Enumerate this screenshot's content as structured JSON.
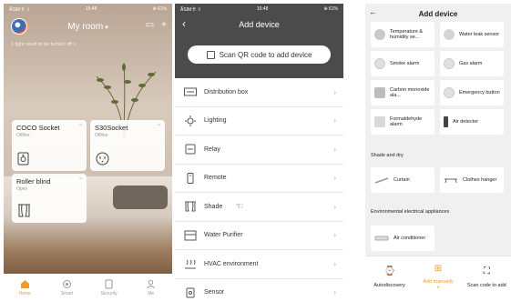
{
  "phone1": {
    "status": {
      "left": "ÃSIM卡 ⇧",
      "time": "15:48",
      "right": "⊕ 61%"
    },
    "room_title": "My room",
    "notice": "1 light need to be turned off >",
    "cards": [
      {
        "name": "COCO Socket",
        "status": "Offline",
        "more": "···"
      },
      {
        "name": "S30Socket",
        "status": "Offline",
        "more": "···"
      },
      {
        "name": "Roller blind",
        "status": "Open",
        "more": "···"
      }
    ],
    "tabs": [
      {
        "label": "Home",
        "icon": "home-icon"
      },
      {
        "label": "Smart",
        "icon": "smart-icon"
      },
      {
        "label": "Security",
        "icon": "security-icon"
      },
      {
        "label": "Me",
        "icon": "person-icon"
      }
    ],
    "accent": "#f39a2b"
  },
  "phone2": {
    "status": {
      "left": "ÃSIM卡 ⇧",
      "time": "15:48",
      "right": "⊕ 61%"
    },
    "title": "Add device",
    "scan_label": "Scan QR code to add device",
    "categories": [
      {
        "label": "Distribution box",
        "icon": "distribution-box-icon"
      },
      {
        "label": "Lighting",
        "icon": "lighting-icon"
      },
      {
        "label": "Relay",
        "icon": "relay-icon"
      },
      {
        "label": "Remote",
        "icon": "remote-icon"
      },
      {
        "label": "Shade",
        "icon": "shade-icon"
      },
      {
        "label": "Water Purifier",
        "icon": "water-purifier-icon"
      },
      {
        "label": "HVAC environment",
        "icon": "hvac-icon"
      },
      {
        "label": "Sensor",
        "icon": "sensor-icon"
      }
    ]
  },
  "phone3": {
    "title": "Add device",
    "devices_top": [
      {
        "label": "Temperature & humidity se...",
        "icon": "temperature-sensor-icon"
      },
      {
        "label": "Water leak sensor",
        "icon": "water-leak-icon"
      },
      {
        "label": "Smoke alarm",
        "icon": "smoke-alarm-icon"
      },
      {
        "label": "Gas alarm",
        "icon": "gas-alarm-icon"
      },
      {
        "label": "Carbon monoxide ala...",
        "icon": "co-alarm-icon"
      },
      {
        "label": "Emergency button",
        "icon": "emergency-button-icon"
      },
      {
        "label": "Formaldehyde alarm",
        "icon": "formaldehyde-icon"
      },
      {
        "label": "Air detector",
        "icon": "air-detector-icon"
      }
    ],
    "section_shade": "Shade and dry",
    "devices_shade": [
      {
        "label": "Curtain",
        "icon": "curtain-icon"
      },
      {
        "label": "Clothes hanger",
        "icon": "clothes-hanger-icon"
      }
    ],
    "section_env": "Environmental electrical appliances",
    "devices_env": [
      {
        "label": "Air conditioner",
        "icon": "air-conditioner-icon"
      }
    ],
    "bottom": [
      {
        "label": "Autodiscovery",
        "icon": "autodiscovery-icon"
      },
      {
        "label": "Add manually",
        "icon": "add-manually-icon"
      },
      {
        "label": "Scan code to add",
        "icon": "scan-icon"
      }
    ]
  }
}
